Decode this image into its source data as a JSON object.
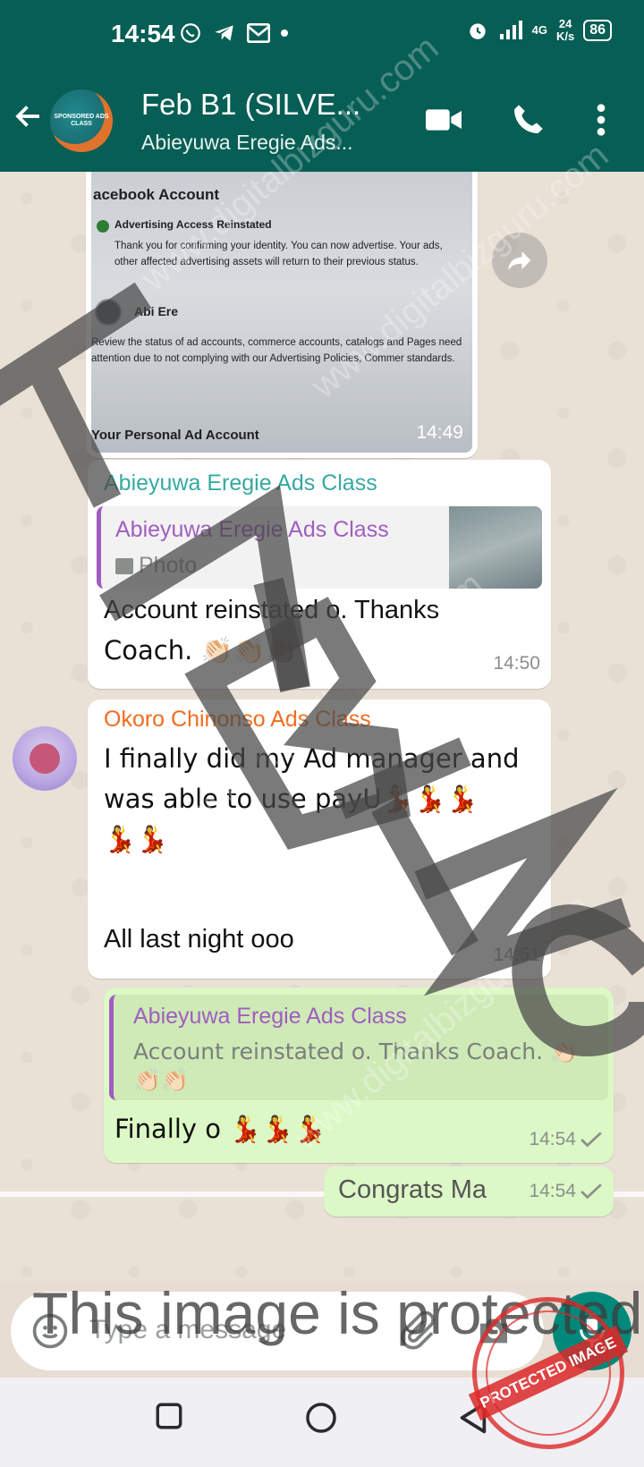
{
  "status_bar": {
    "time": "14:54",
    "network": "4G",
    "speed_value": "24",
    "speed_unit": "K/s",
    "battery": "86"
  },
  "header": {
    "title": "Feb B1 (SILVE...",
    "subtitle": "Abieyuwa Eregie Ads...",
    "avatar_text": "SPONSORED ADS CLASS"
  },
  "messages": {
    "image_message": {
      "photo_title": "acebook Account",
      "photo_heading": "Advertising Access Reinstated",
      "photo_body": "Thank you for confirming your identity. You can now advertise. Your ads, other affected advertising assets will return to their previous status.",
      "photo_name": "Abi Ere",
      "photo_review": "Review the status of ad accounts, commerce accounts, catalogs and Pages need attention due to not complying with our Advertising Policies, Commer standards.",
      "photo_footer": "Your Personal Ad Account",
      "time": "14:49"
    },
    "reply_message": {
      "sender": "Abieyuwa Eregie Ads Class",
      "quote_sender": "Abieyuwa Eregie Ads Class",
      "quote_text": "Photo",
      "text_line1": "Account reinstated o. Thanks",
      "text_line2": "Coach. 👏🏻👏🏻👏🏽",
      "time": "14:50"
    },
    "okoro_message": {
      "sender": "Okoro Chinonso Ads Class",
      "text_line1": "I finally did my Ad manager and",
      "text_line2": "was able to use payU💃💃💃",
      "text_line3": "💃💃",
      "text_line4": "All last night ooo",
      "time": "14:51"
    },
    "out_message": {
      "quote_sender": "Abieyuwa Eregie Ads Class",
      "quote_line1": "Account reinstated o. Thanks Coach. 👏🏻",
      "quote_line2": "👏🏻👏🏻",
      "text": "Finally o 💃💃💃",
      "time": "14:54"
    },
    "out_message2": {
      "text": "Congrats Ma",
      "time": "14:54"
    }
  },
  "input": {
    "placeholder": "Type a message"
  },
  "watermarks": {
    "site": "www.digitalbizguru.com",
    "overlay": "This image is protected",
    "stamp": "PROTECTED IMAGE",
    "big_letters": "TALBIZG"
  },
  "colors": {
    "header": "#075e54",
    "out_bubble": "#dcf8c6",
    "sender_teal": "#35aaa1",
    "sender_orange": "#f06d1f",
    "quote_purple": "#a05ec0"
  }
}
